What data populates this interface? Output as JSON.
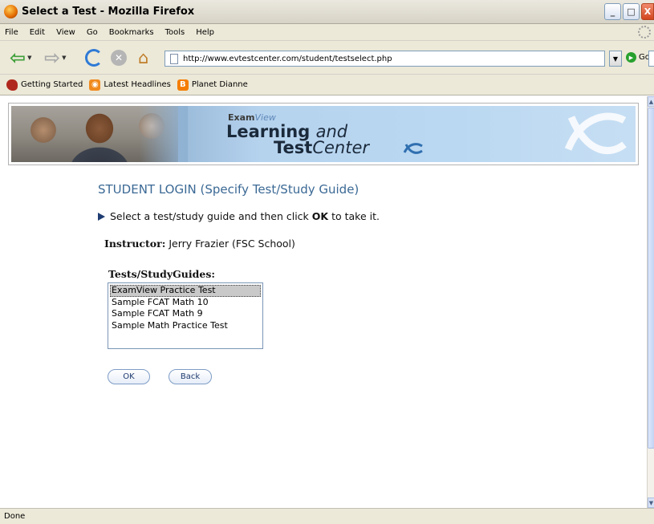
{
  "window": {
    "title": "Select a Test - Mozilla Firefox",
    "buttons": {
      "minimize": "_",
      "maximize": "□",
      "close": "X"
    }
  },
  "menu": [
    "File",
    "Edit",
    "View",
    "Go",
    "Bookmarks",
    "Tools",
    "Help"
  ],
  "nav": {
    "url": "http://www.evtestcenter.com/student/testselect.php",
    "go_label": "Go",
    "search_engine_icon": "google-icon"
  },
  "bookmarks": [
    {
      "label": "Getting Started",
      "icon": "firefox-icon"
    },
    {
      "label": "Latest Headlines",
      "icon": "rss-icon"
    },
    {
      "label": "Planet Dianne",
      "icon": "blogger-icon"
    }
  ],
  "banner": {
    "brand_prefix": "Exam",
    "brand_suffix": "View",
    "line1_bold": "Learning",
    "line1_italic": "and",
    "line2_bold": "Test",
    "line2_italic": "Center"
  },
  "page": {
    "heading": "STUDENT LOGIN (Specify Test/Study Guide)",
    "instruction_pre": "Select a test/study guide and then click",
    "instruction_bold": "OK",
    "instruction_post": "to take it.",
    "instructor_label": "Instructor:",
    "instructor_value": "Jerry Frazier (FSC School)",
    "tests_label": "Tests/StudyGuides:",
    "tests": [
      "ExamView Practice Test",
      "Sample FCAT Math 10",
      "Sample FCAT Math 9",
      "Sample Math Practice Test"
    ],
    "selected_test": "ExamView Practice Test",
    "ok_label": "OK",
    "back_label": "Back"
  },
  "status": {
    "text": "Done"
  },
  "colors": {
    "heading": "#3b6995",
    "banner_blue": "#b6d3ee",
    "chrome": "#ece9d8"
  }
}
